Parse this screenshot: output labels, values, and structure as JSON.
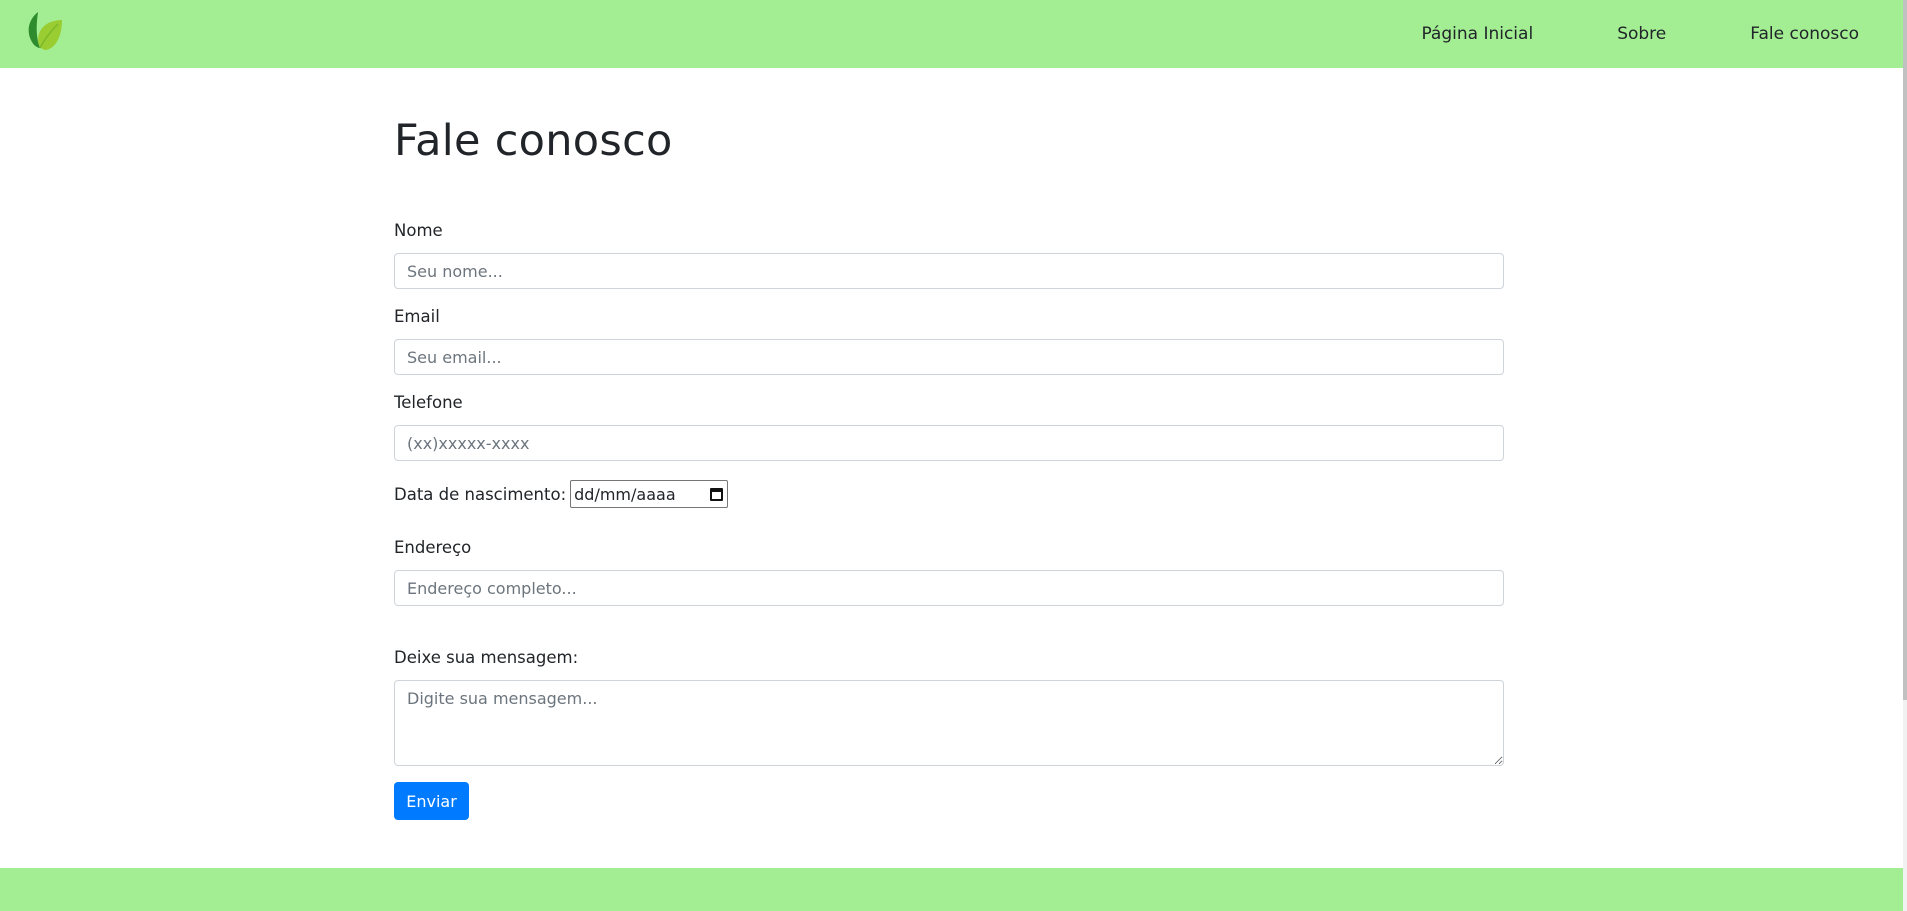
{
  "nav": {
    "links": [
      "Página Inicial",
      "Sobre",
      "Fale conosco"
    ]
  },
  "colors": {
    "navbar_bg": "#a3ee93",
    "footer_bg": "#a3ee93",
    "primary_button": "#007bff",
    "logo_dark": "#2e8b2e",
    "logo_light": "#9acd32"
  },
  "icons": {
    "logo": "leaf-icon",
    "date_picker": "calendar-icon"
  },
  "form": {
    "title": "Fale conosco",
    "name": {
      "label": "Nome",
      "placeholder": "Seu nome..."
    },
    "email": {
      "label": "Email",
      "placeholder": "Seu email..."
    },
    "phone": {
      "label": "Telefone",
      "placeholder": "(xx)xxxxx-xxxx"
    },
    "birthdate": {
      "label": "Data de nascimento:",
      "placeholder": "dd/mm/aaaa"
    },
    "address": {
      "label": "Endereço",
      "placeholder": "Endereço completo..."
    },
    "message": {
      "label": "Deixe sua mensagem:",
      "placeholder": "Digite sua mensagem..."
    },
    "submit_label": "Enviar"
  }
}
